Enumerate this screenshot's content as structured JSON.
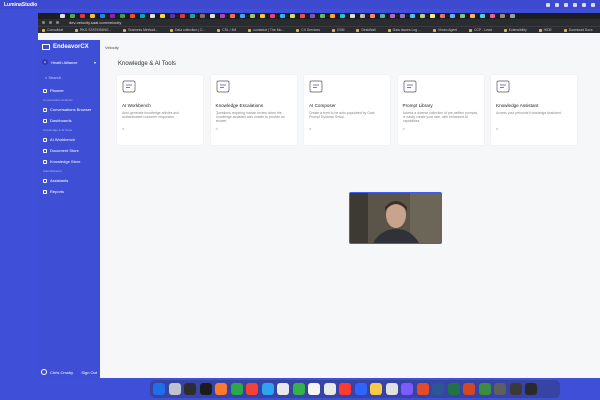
{
  "menubar": {
    "app_name": "LuminaStudio"
  },
  "browser": {
    "url": "dev-velocity.saal.com/velocity",
    "bookmarks": [
      "Consolidat",
      "RKG STATIONING...",
      "Business Methodi...",
      "Data collection | C...",
      "CSL / 4M",
      "contadue | The Mo...",
      "CX Services",
      "CSM",
      "DeskWall",
      "Gaia Issues Log ...",
      "Vimeo Agent",
      "CCP - Lead",
      "Extensibility",
      "HIDE",
      "Download Docs",
      "CX Teams Overview"
    ]
  },
  "sidebar": {
    "brand": "EndeavorCX",
    "org": {
      "initials": "H",
      "name": "Health Alliance"
    },
    "search_placeholder": "Search",
    "items": [
      {
        "label": "Planner",
        "icon": "calendar-icon"
      },
      {
        "group": "Conversation Analysis"
      },
      {
        "label": "Conversations Browser",
        "icon": "chat-icon"
      },
      {
        "label": "Dashboards",
        "icon": "dashboard-icon"
      },
      {
        "group": "Knowledge & AI Tools"
      },
      {
        "label": "AI Workbench",
        "icon": "flask-icon"
      },
      {
        "label": "Document Store",
        "icon": "document-icon"
      },
      {
        "label": "Knowledge Store",
        "icon": "book-icon"
      },
      {
        "group": "Administration"
      },
      {
        "label": "Assistants",
        "icon": "gear-icon"
      },
      {
        "label": "Reports",
        "icon": "reports-icon"
      }
    ],
    "user": {
      "name": "Chris Crosby",
      "sign_out": "Sign Out"
    }
  },
  "main": {
    "breadcrumb": "Velocity",
    "title": "Knowledge & AI Tools",
    "cards": [
      {
        "title": "AI Workbench",
        "desc": "Auto-generate knowledge articles and authenticated customer responses.",
        "icon": "workbench-icon",
        "arrow": ">"
      },
      {
        "title": "Knowledge Escalations",
        "desc": "Questions requiring human review when the knowledge assistant was unable to provide an answer.",
        "icon": "escalation-icon",
        "arrow": ">"
      },
      {
        "title": "AI Composer",
        "desc": "Create a form to be auto-populated by Gaal Prompt Dynamic Setup.",
        "icon": "composer-icon",
        "arrow": ">"
      },
      {
        "title": "Prompt Library",
        "desc": "Access a diverse collection of pre-written prompts, or easily create your own, with enhanced AI capabilities.",
        "icon": "library-icon",
        "arrow": ">"
      },
      {
        "title": "Knowledge Assistant",
        "desc": "Access your personal Knowledge Assistant.",
        "icon": "assistant-icon",
        "arrow": ">"
      }
    ]
  },
  "colors": {
    "sidebar": "#3e4fd6",
    "desktop": "#3f4fd8",
    "webcam_border": "#3a5ef5"
  }
}
